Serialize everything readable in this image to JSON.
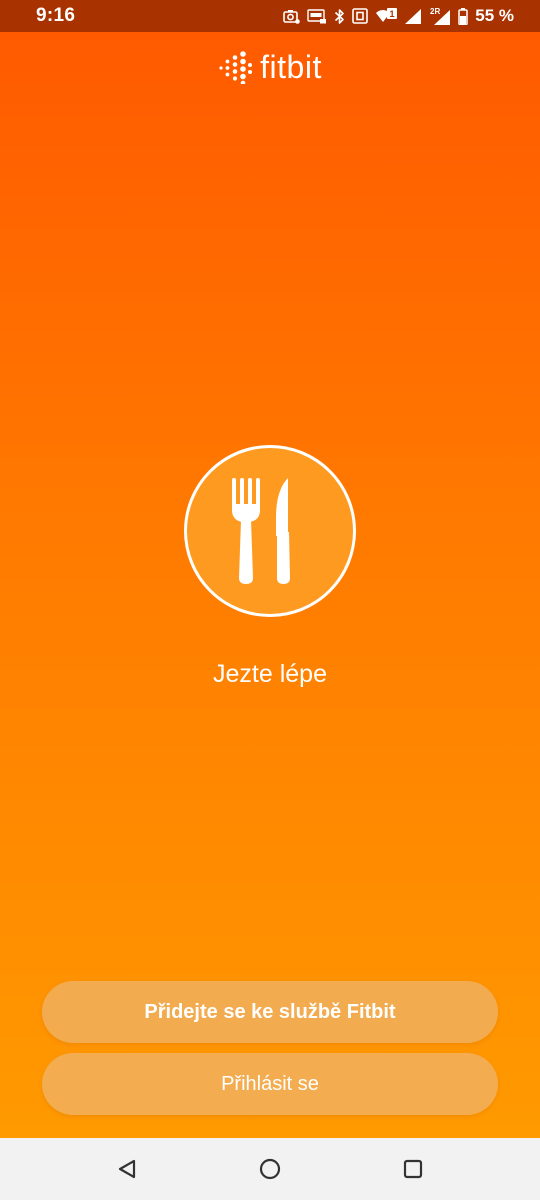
{
  "status_bar": {
    "time": "9:16",
    "battery": "55 %",
    "icons": [
      "screenshot-icon",
      "auto-brightness-icon",
      "bluetooth-icon",
      "nfc-icon",
      "wifi-icon",
      "signal-icon",
      "signal-icon",
      "battery-icon"
    ],
    "wifi_badge": "1",
    "signal_badge": "2R"
  },
  "header": {
    "brand_name": "fitbit",
    "logo_icon": "fitbit-dots-logo-icon"
  },
  "onboarding": {
    "icon": "fork-knife-icon",
    "tagline": "Jezte lépe"
  },
  "actions": {
    "join_label": "Přidejte se ke službě Fitbit",
    "login_label": "Přihlásit se"
  },
  "nav_bar": {
    "back_icon": "back-triangle-icon",
    "home_icon": "home-circle-icon",
    "recents_icon": "recents-square-icon"
  },
  "colors": {
    "gradient_top": "#ff5a00",
    "gradient_bottom": "#ff9a00",
    "status_bar": "#a83300",
    "nav_bar": "#f2f2f2"
  }
}
